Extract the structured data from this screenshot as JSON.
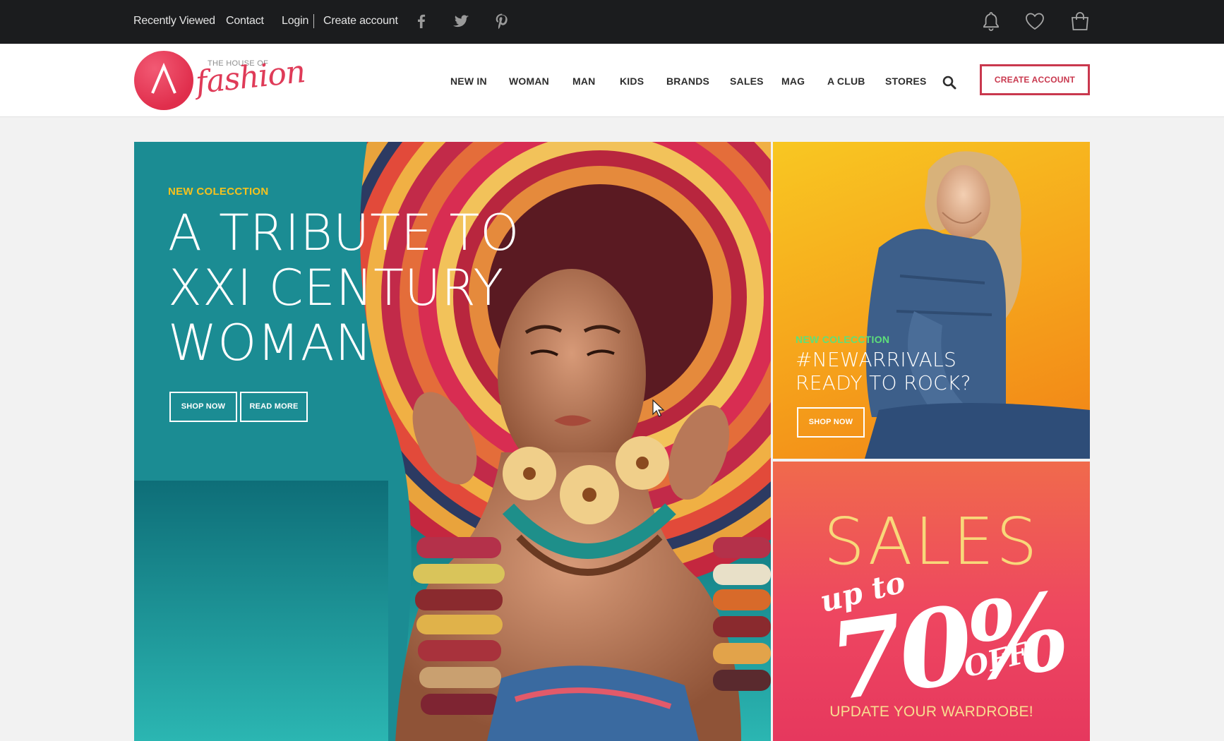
{
  "topbar": {
    "recently_viewed": "Recently Viewed",
    "contact": "Contact",
    "login": "Login",
    "create_account": "Create account",
    "social_icons": [
      "facebook-icon",
      "twitter-icon",
      "pinterest-icon"
    ],
    "action_icons": [
      "bell-icon",
      "heart-icon",
      "shopping-bag-icon"
    ]
  },
  "logo": {
    "line1": "THE HOUSE OF",
    "line2": "fashion",
    "mark": "A"
  },
  "nav": {
    "items": [
      "NEW IN",
      "WOMAN",
      "MAN",
      "KIDS",
      "BRANDS",
      "SALES",
      "MAG",
      "A CLUB",
      "STORES"
    ],
    "cta": "CREATE ACCOUNT"
  },
  "hero": {
    "kicker": "NEW COLECCTION",
    "title_lines": [
      "A TRIBUTE TO",
      "XXI CENTURY",
      "WOMAN"
    ],
    "shop_now": "SHOP NOW",
    "read_more": "READ MORE"
  },
  "promo_arrivals": {
    "kicker": "NEW COLECCTION",
    "title_lines": [
      "#NEWARRIVALS",
      "READY TO ROCK?"
    ],
    "shop_now": "SHOP NOW"
  },
  "promo_sales": {
    "headline": "SALES",
    "up_to": "up to",
    "percent": "70%",
    "off": "OFF",
    "tagline": "UPDATE YOUR WARDROBE!"
  },
  "colors": {
    "topbar": "#1b1c1e",
    "brand": "#e0304f",
    "cta_border": "#c9384e",
    "hero_teal": "#127e87",
    "kicker_yellow": "#f6c21d",
    "kicker_green": "#5ee07a",
    "promo_orange": "#f6a61c",
    "promo_pink": "#ee4660"
  }
}
